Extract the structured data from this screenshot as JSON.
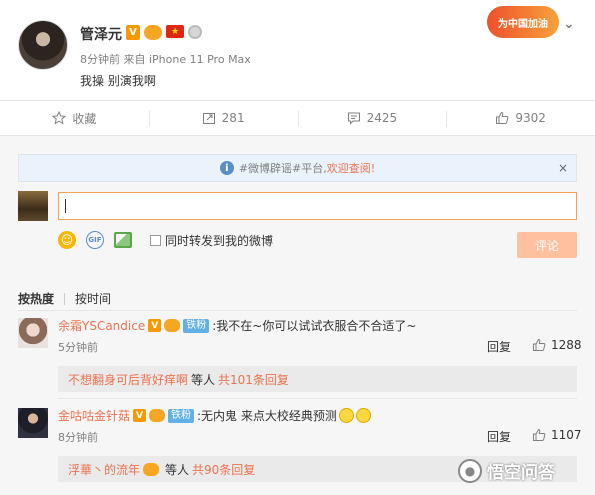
{
  "post": {
    "username": "管泽元",
    "time": "8分钟前",
    "source": "来自 iPhone 11 Pro Max",
    "text": "我操 别演我啊",
    "promo": "为中国加油",
    "badges": {
      "v": "V",
      "flag": "★"
    }
  },
  "actions": {
    "favorite": "收藏",
    "repost": "281",
    "comment": "2425",
    "like": "9302"
  },
  "notice": {
    "prefix": "#微博辟谣#平台,",
    "highlight": "欢迎查阅!",
    "close": "×"
  },
  "composer": {
    "sync_label": "同时转发到我的微博",
    "submit": "评论",
    "gif": "GIF"
  },
  "sort": {
    "by_hot": "按热度",
    "by_time": "按时间"
  },
  "comments": [
    {
      "user": "余霜YSCandice",
      "fan_badge": "铁粉",
      "text": ":我不在~你可以试试衣服合不合适了~",
      "time": "5分钟前",
      "reply": "回复",
      "likes": "1288",
      "sub_user": "不想翻身可后背好痒啊",
      "sub_mid": "等人",
      "sub_count": "共101条回复"
    },
    {
      "user": "金咕咕金针菇",
      "fan_badge": "铁粉",
      "text": ":无内鬼 来点大校经典预测",
      "time": "8分钟前",
      "reply": "回复",
      "likes": "1107",
      "sub_user": "浮華丶的流年",
      "sub_mid": "等人",
      "sub_count": "共90条回复"
    }
  ],
  "watermark": "悟空问答"
}
